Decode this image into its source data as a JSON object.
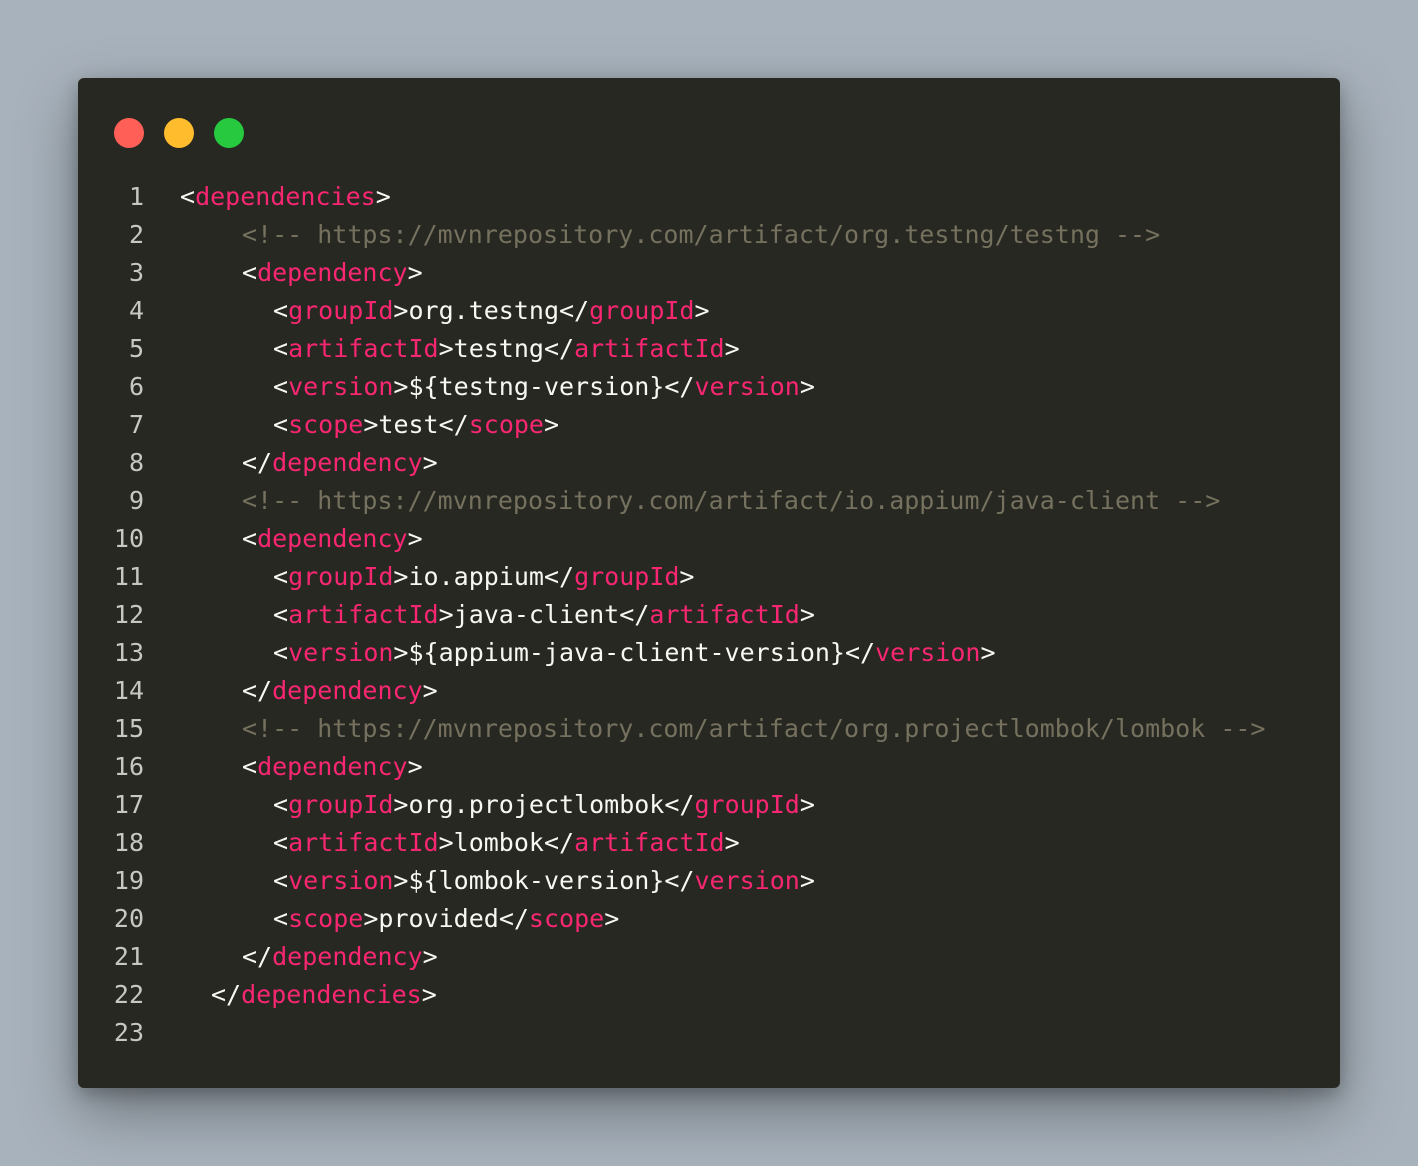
{
  "window": {
    "controls": [
      {
        "name": "close",
        "color": "#ff5f56"
      },
      {
        "name": "minimize",
        "color": "#ffbd2e"
      },
      {
        "name": "maximize",
        "color": "#27c93f"
      }
    ]
  },
  "code": {
    "lines": [
      {
        "n": "1",
        "indent": 0,
        "tokens": [
          [
            "p",
            "<"
          ],
          [
            "t",
            "dependencies"
          ],
          [
            "p",
            ">"
          ]
        ]
      },
      {
        "n": "2",
        "indent": 2,
        "tokens": [
          [
            "c",
            "<!-- https://mvnrepository.com/artifact/org.testng/testng -->"
          ]
        ]
      },
      {
        "n": "3",
        "indent": 2,
        "tokens": [
          [
            "p",
            "<"
          ],
          [
            "t",
            "dependency"
          ],
          [
            "p",
            ">"
          ]
        ]
      },
      {
        "n": "4",
        "indent": 3,
        "tokens": [
          [
            "p",
            "<"
          ],
          [
            "t",
            "groupId"
          ],
          [
            "p",
            ">"
          ],
          [
            "v",
            "org.testng"
          ],
          [
            "p",
            "</"
          ],
          [
            "t",
            "groupId"
          ],
          [
            "p",
            ">"
          ]
        ]
      },
      {
        "n": "5",
        "indent": 3,
        "tokens": [
          [
            "p",
            "<"
          ],
          [
            "t",
            "artifactId"
          ],
          [
            "p",
            ">"
          ],
          [
            "v",
            "testng"
          ],
          [
            "p",
            "</"
          ],
          [
            "t",
            "artifactId"
          ],
          [
            "p",
            ">"
          ]
        ]
      },
      {
        "n": "6",
        "indent": 3,
        "tokens": [
          [
            "p",
            "<"
          ],
          [
            "t",
            "version"
          ],
          [
            "p",
            ">"
          ],
          [
            "v",
            "${testng-version}"
          ],
          [
            "p",
            "</"
          ],
          [
            "t",
            "version"
          ],
          [
            "p",
            ">"
          ]
        ]
      },
      {
        "n": "7",
        "indent": 3,
        "tokens": [
          [
            "p",
            "<"
          ],
          [
            "t",
            "scope"
          ],
          [
            "p",
            ">"
          ],
          [
            "v",
            "test"
          ],
          [
            "p",
            "</"
          ],
          [
            "t",
            "scope"
          ],
          [
            "p",
            ">"
          ]
        ]
      },
      {
        "n": "8",
        "indent": 2,
        "tokens": [
          [
            "p",
            "</"
          ],
          [
            "t",
            "dependency"
          ],
          [
            "p",
            ">"
          ]
        ]
      },
      {
        "n": "9",
        "indent": 2,
        "tokens": [
          [
            "c",
            "<!-- https://mvnrepository.com/artifact/io.appium/java-client -->"
          ]
        ]
      },
      {
        "n": "10",
        "indent": 2,
        "tokens": [
          [
            "p",
            "<"
          ],
          [
            "t",
            "dependency"
          ],
          [
            "p",
            ">"
          ]
        ]
      },
      {
        "n": "11",
        "indent": 3,
        "tokens": [
          [
            "p",
            "<"
          ],
          [
            "t",
            "groupId"
          ],
          [
            "p",
            ">"
          ],
          [
            "v",
            "io.appium"
          ],
          [
            "p",
            "</"
          ],
          [
            "t",
            "groupId"
          ],
          [
            "p",
            ">"
          ]
        ]
      },
      {
        "n": "12",
        "indent": 3,
        "tokens": [
          [
            "p",
            "<"
          ],
          [
            "t",
            "artifactId"
          ],
          [
            "p",
            ">"
          ],
          [
            "v",
            "java-client"
          ],
          [
            "p",
            "</"
          ],
          [
            "t",
            "artifactId"
          ],
          [
            "p",
            ">"
          ]
        ]
      },
      {
        "n": "13",
        "indent": 3,
        "tokens": [
          [
            "p",
            "<"
          ],
          [
            "t",
            "version"
          ],
          [
            "p",
            ">"
          ],
          [
            "v",
            "${appium-java-client-version}"
          ],
          [
            "p",
            "</"
          ],
          [
            "t",
            "version"
          ],
          [
            "p",
            ">"
          ]
        ]
      },
      {
        "n": "14",
        "indent": 2,
        "tokens": [
          [
            "p",
            "</"
          ],
          [
            "t",
            "dependency"
          ],
          [
            "p",
            ">"
          ]
        ]
      },
      {
        "n": "15",
        "indent": 2,
        "tokens": [
          [
            "c",
            "<!-- https://mvnrepository.com/artifact/org.projectlombok/lombok -->"
          ]
        ]
      },
      {
        "n": "16",
        "indent": 2,
        "tokens": [
          [
            "p",
            "<"
          ],
          [
            "t",
            "dependency"
          ],
          [
            "p",
            ">"
          ]
        ]
      },
      {
        "n": "17",
        "indent": 3,
        "tokens": [
          [
            "p",
            "<"
          ],
          [
            "t",
            "groupId"
          ],
          [
            "p",
            ">"
          ],
          [
            "v",
            "org.projectlombok"
          ],
          [
            "p",
            "</"
          ],
          [
            "t",
            "groupId"
          ],
          [
            "p",
            ">"
          ]
        ]
      },
      {
        "n": "18",
        "indent": 3,
        "tokens": [
          [
            "p",
            "<"
          ],
          [
            "t",
            "artifactId"
          ],
          [
            "p",
            ">"
          ],
          [
            "v",
            "lombok"
          ],
          [
            "p",
            "</"
          ],
          [
            "t",
            "artifactId"
          ],
          [
            "p",
            ">"
          ]
        ]
      },
      {
        "n": "19",
        "indent": 3,
        "tokens": [
          [
            "p",
            "<"
          ],
          [
            "t",
            "version"
          ],
          [
            "p",
            ">"
          ],
          [
            "v",
            "${lombok-version}"
          ],
          [
            "p",
            "</"
          ],
          [
            "t",
            "version"
          ],
          [
            "p",
            ">"
          ]
        ]
      },
      {
        "n": "20",
        "indent": 3,
        "tokens": [
          [
            "p",
            "<"
          ],
          [
            "t",
            "scope"
          ],
          [
            "p",
            ">"
          ],
          [
            "v",
            "provided"
          ],
          [
            "p",
            "</"
          ],
          [
            "t",
            "scope"
          ],
          [
            "p",
            ">"
          ]
        ]
      },
      {
        "n": "21",
        "indent": 2,
        "tokens": [
          [
            "p",
            "</"
          ],
          [
            "t",
            "dependency"
          ],
          [
            "p",
            ">"
          ]
        ]
      },
      {
        "n": "22",
        "indent": 1,
        "tokens": [
          [
            "p",
            "</"
          ],
          [
            "t",
            "dependencies"
          ],
          [
            "p",
            ">"
          ]
        ]
      },
      {
        "n": "23",
        "indent": 0,
        "tokens": []
      }
    ]
  }
}
